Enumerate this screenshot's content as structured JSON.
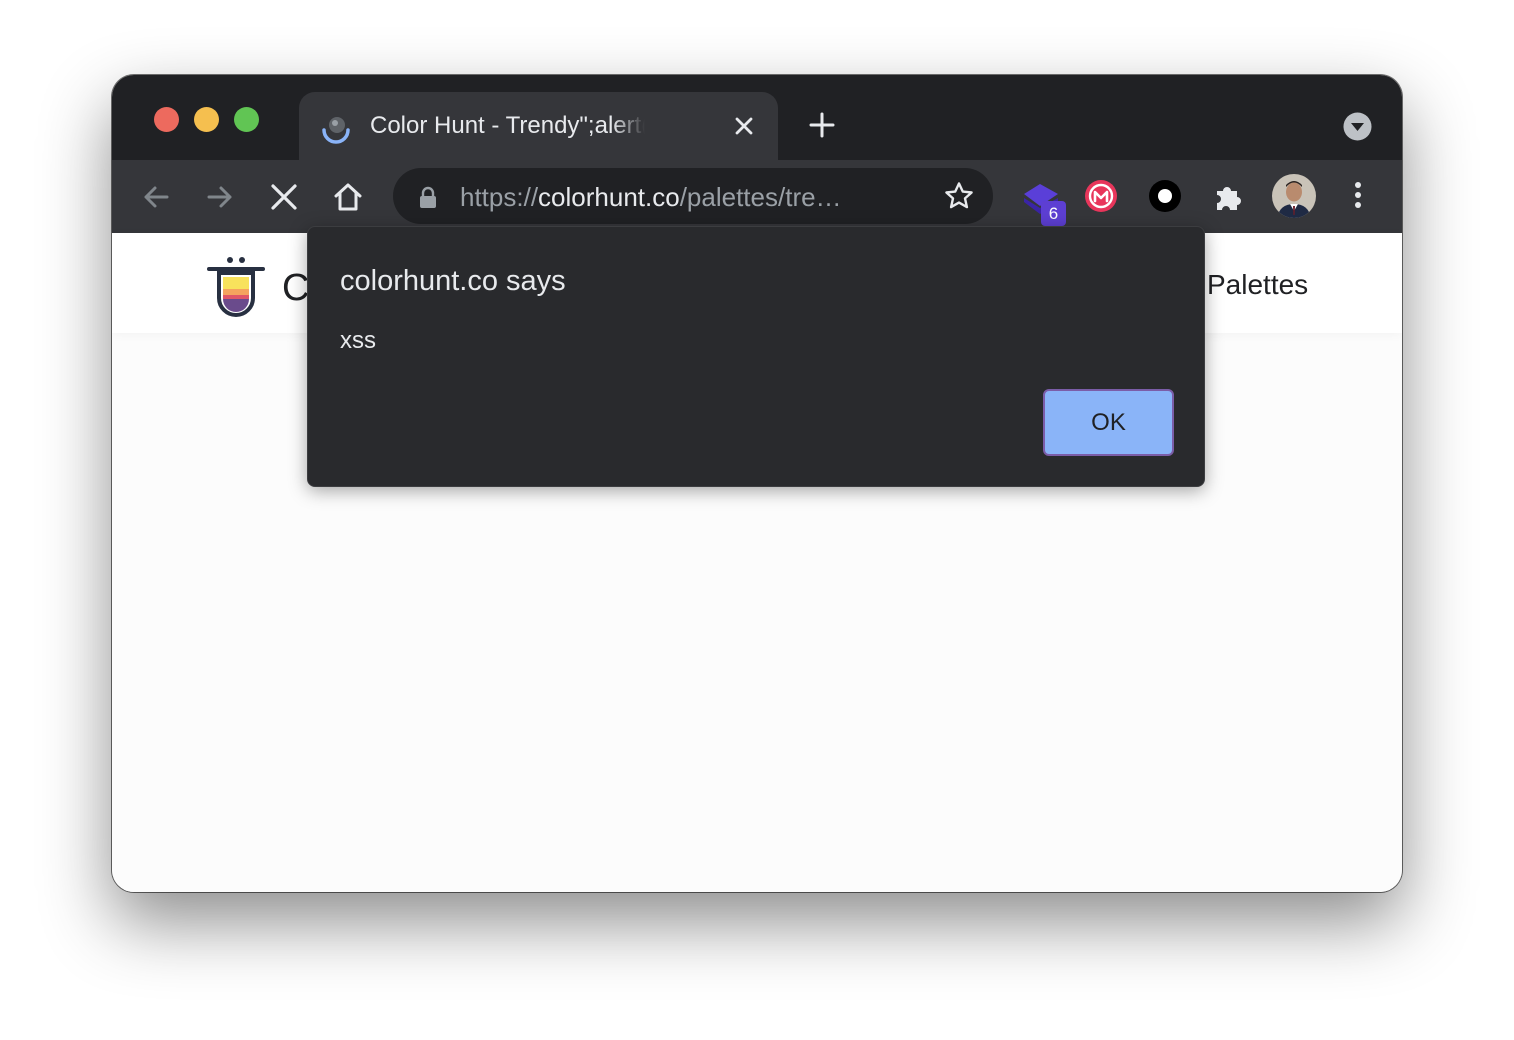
{
  "browser": {
    "tab": {
      "title": "Color Hunt - Trendy\";alert('xss')"
    },
    "address_bar": {
      "scheme": "https://",
      "host": "colorhunt.co",
      "path": "/palettes/tre…"
    },
    "extension_badge_count": "6"
  },
  "page": {
    "site_name": "C",
    "nav_link": "Palettes"
  },
  "dialog": {
    "title": "colorhunt.co says",
    "message": "xss",
    "ok_label": "OK"
  },
  "colors": {
    "titlebar": "#202124",
    "toolbar": "#35363a",
    "dialog_bg": "#292a2d",
    "ok_button": "#8ab4f8"
  }
}
